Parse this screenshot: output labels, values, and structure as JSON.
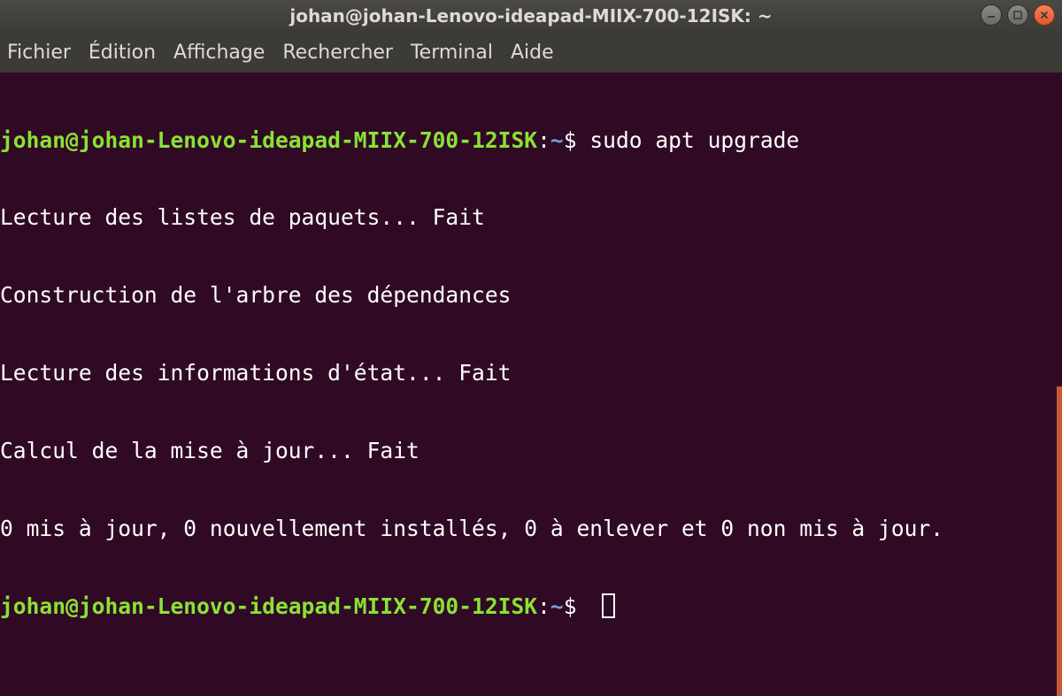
{
  "window": {
    "title": "johan@johan-Lenovo-ideapad-MIIX-700-12ISK: ~",
    "controls": [
      "minimize-icon",
      "maximize-icon",
      "close-icon"
    ]
  },
  "menu": {
    "items": [
      "Fichier",
      "Édition",
      "Affichage",
      "Rechercher",
      "Terminal",
      "Aide"
    ]
  },
  "terminal": {
    "prompt_user": "johan@johan-Lenovo-ideapad-MIIX-700-12ISK",
    "prompt_colon": ":",
    "prompt_path": "~",
    "prompt_symbol": "$ ",
    "command": "sudo apt upgrade",
    "output": [
      "Lecture des listes de paquets... Fait",
      "Construction de l'arbre des dépendances",
      "Lecture des informations d'état... Fait",
      "Calcul de la mise à jour... Fait",
      "0 mis à jour, 0 nouvellement installés, 0 à enlever et 0 non mis à jour."
    ]
  },
  "colors": {
    "background": "#300a24",
    "prompt_user": "#8ae234",
    "prompt_path": "#729fcf",
    "text": "#ffffff",
    "scrollbar": "#e0683c"
  }
}
